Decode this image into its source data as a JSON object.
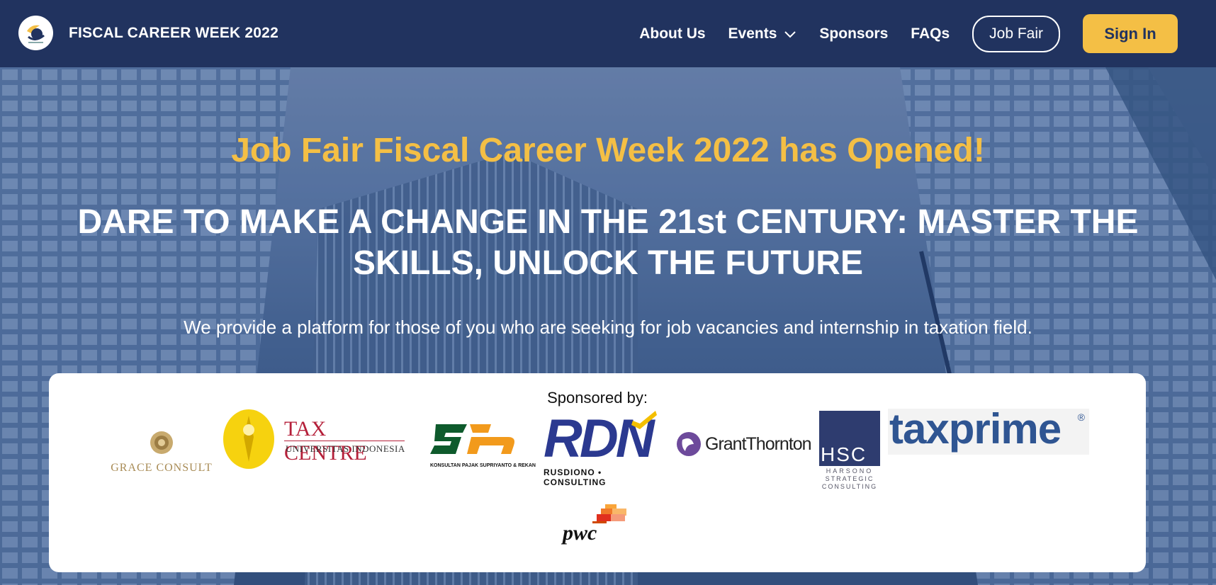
{
  "nav": {
    "brand_title": "FISCAL CAREER WEEK 2022",
    "links": [
      "About Us",
      "Events",
      "Sponsors",
      "FAQs"
    ],
    "job_fair": "Job Fair",
    "sign_in": "Sign In"
  },
  "hero": {
    "headline": "Job Fair Fiscal Career Week 2022 has Opened!",
    "subhead": "DARE TO MAKE A CHANGE IN THE 21st CENTURY: MASTER THE SKILLS, UNLOCK THE FUTURE",
    "tagline": "We provide a platform for those of you who are seeking for job vacancies and internship in taxation field."
  },
  "sponsors": {
    "title": "Sponsored by:",
    "grace": "GRACE CONSULT",
    "taxcentre": "TAX CENTRE",
    "taxcentre_sub": "UNIVERSITAS INDONESIA",
    "ksr": "KONSULTAN PAJAK SUPRIYANTO & REKAN",
    "rdn": "RDN",
    "rdn_sub": "RUSDIONO • CONSULTING",
    "grant": "GrantThornton",
    "hsc": "HSC",
    "hsc_sub1": "HARSONO",
    "hsc_sub2": "STRATEGIC",
    "hsc_sub3": "CONSULTING",
    "taxprime": "taxprime",
    "pwc": "pwc"
  },
  "colors": {
    "navy": "#21335f",
    "gold": "#f4bf45",
    "white": "#ffffff"
  }
}
